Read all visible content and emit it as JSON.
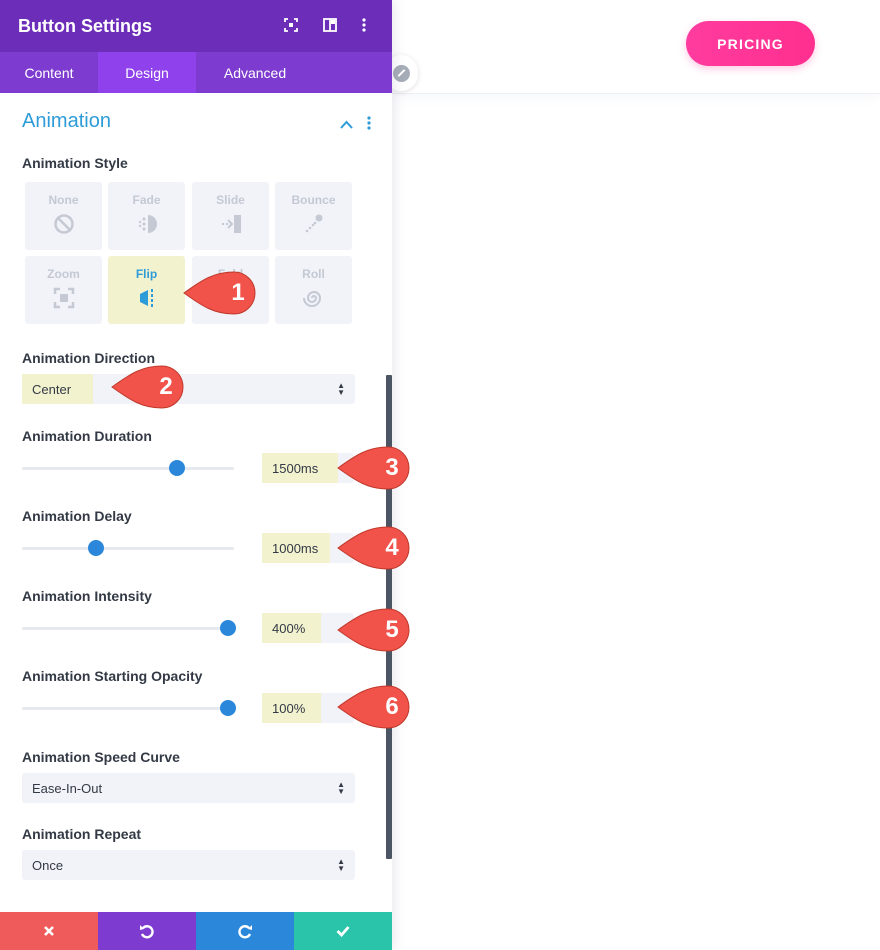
{
  "page": {
    "pricing_label": "PRICING"
  },
  "panel": {
    "title": "Button Settings",
    "tabs": [
      {
        "label": "Content",
        "active": false
      },
      {
        "label": "Design",
        "active": true
      },
      {
        "label": "Advanced",
        "active": false
      }
    ],
    "section_title": "Animation",
    "animation_style": {
      "label": "Animation Style",
      "options": [
        {
          "label": "None",
          "icon": "none-icon"
        },
        {
          "label": "Fade",
          "icon": "fade-icon"
        },
        {
          "label": "Slide",
          "icon": "slide-icon"
        },
        {
          "label": "Bounce",
          "icon": "bounce-icon"
        },
        {
          "label": "Zoom",
          "icon": "zoom-icon"
        },
        {
          "label": "Flip",
          "icon": "flip-icon",
          "selected": true
        },
        {
          "label": "Fold",
          "icon": "fold-icon"
        },
        {
          "label": "Roll",
          "icon": "roll-icon"
        }
      ]
    },
    "direction": {
      "label": "Animation Direction",
      "value": "Center"
    },
    "duration": {
      "label": "Animation Duration",
      "value": "1500ms",
      "slider_fraction": 0.73
    },
    "delay": {
      "label": "Animation Delay",
      "value": "1000ms",
      "slider_fraction": 0.35
    },
    "intensity": {
      "label": "Animation Intensity",
      "value": "400%",
      "slider_fraction": 0.97
    },
    "opacity": {
      "label": "Animation Starting Opacity",
      "value": "100%",
      "slider_fraction": 0.97
    },
    "speed_curve": {
      "label": "Animation Speed Curve",
      "value": "Ease-In-Out"
    },
    "repeat": {
      "label": "Animation Repeat",
      "value": "Once"
    }
  },
  "markers": [
    "1",
    "2",
    "3",
    "4",
    "5",
    "6"
  ],
  "colors": {
    "panel_header": "#6c2eb9",
    "tab_bar": "#7e3bd0",
    "active_tab": "#8f42ec",
    "accent_blue": "#2e9cd8",
    "slider_thumb": "#2b87da",
    "highlight": "#f3f2cf",
    "marker_red": "#f1524a",
    "footer_cancel": "#ef5a5a",
    "footer_undo": "#7e3bd0",
    "footer_redo": "#2b87da",
    "footer_save": "#29c4a9",
    "pricing_pink": "#ff3c9f"
  }
}
